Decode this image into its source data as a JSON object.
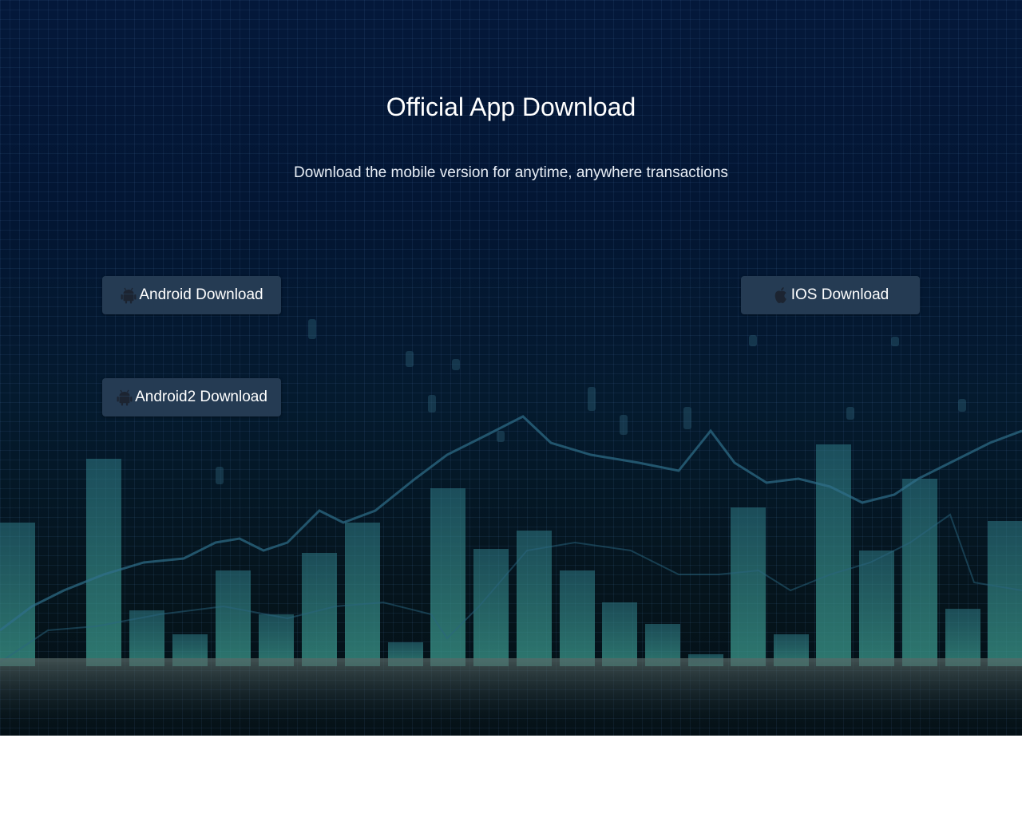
{
  "page": {
    "title": "Official App Download",
    "subtitle": "Download the mobile version for anytime, anywhere transactions"
  },
  "buttons": {
    "android": {
      "label": "Android Download",
      "icon": "android-icon"
    },
    "ios": {
      "label": "IOS Download",
      "icon": "apple-icon"
    },
    "android2": {
      "label": "Android2 Download",
      "icon": "android-icon"
    }
  },
  "colors": {
    "button_bg": "#253b53",
    "icon_color": "#1c2431",
    "title_color": "#ffffff"
  }
}
